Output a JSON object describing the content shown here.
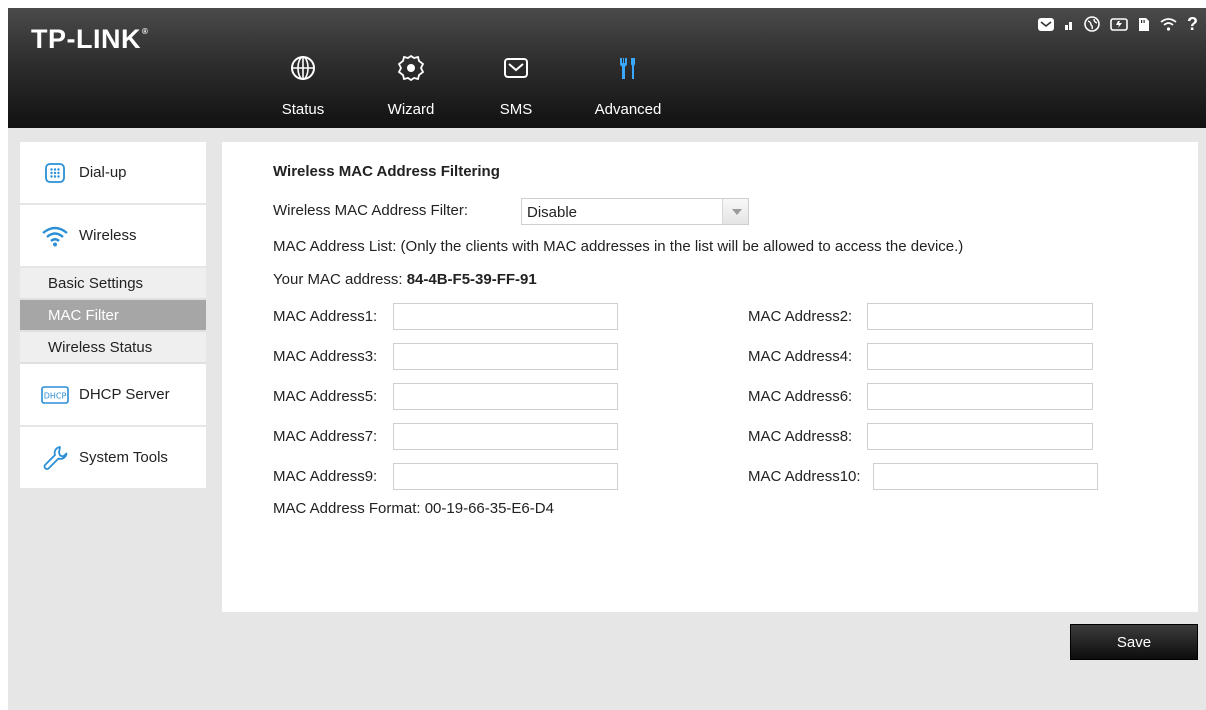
{
  "brand": {
    "logo_text": "TP-LINK",
    "logo_mark": "®"
  },
  "nav": {
    "items": [
      {
        "label": "Status",
        "icon": "globe-icon"
      },
      {
        "label": "Wizard",
        "icon": "gear-icon"
      },
      {
        "label": "SMS",
        "icon": "envelope-icon"
      },
      {
        "label": "Advanced",
        "icon": "tools-icon",
        "active": true
      }
    ]
  },
  "status_bar": {
    "icons": [
      "envelope-icon",
      "signal-icon",
      "globe-icon",
      "battery-icon",
      "sim-icon",
      "wifi-icon",
      "help-icon"
    ],
    "help_glyph": "?"
  },
  "sidebar": {
    "groups": [
      {
        "label": "Dial-up",
        "icon": "dialpad-icon"
      },
      {
        "label": "Wireless",
        "icon": "wifi-icon"
      },
      {
        "label": "DHCP Server",
        "icon": "dhcp-icon"
      },
      {
        "label": "System Tools",
        "icon": "wrench-icon"
      }
    ],
    "wireless_sub": [
      "Basic Settings",
      "MAC Filter",
      "Wireless Status"
    ],
    "active_sub": "MAC Filter",
    "dhcp_icon_text": "DHCP"
  },
  "content": {
    "title": "Wireless MAC Address Filtering",
    "filter_label": "Wireless MAC Address Filter:",
    "filter_value": "Disable",
    "list_note": "MAC Address List: (Only the clients with MAC addresses in the list will be allowed to access the device.)",
    "your_mac_label": "Your MAC address: ",
    "your_mac_value": "84-4B-F5-39-FF-91",
    "mac_fields": [
      {
        "label": "MAC Address1:",
        "value": ""
      },
      {
        "label": "MAC Address2:",
        "value": ""
      },
      {
        "label": "MAC Address3:",
        "value": ""
      },
      {
        "label": "MAC Address4:",
        "value": ""
      },
      {
        "label": "MAC Address5:",
        "value": ""
      },
      {
        "label": "MAC Address6:",
        "value": ""
      },
      {
        "label": "MAC Address7:",
        "value": ""
      },
      {
        "label": "MAC Address8:",
        "value": ""
      },
      {
        "label": "MAC Address9:",
        "value": ""
      },
      {
        "label": "MAC Address10:",
        "value": ""
      }
    ],
    "format_note": "MAC Address Format: 00-19-66-35-E6-D4"
  },
  "actions": {
    "save_label": "Save"
  },
  "colors": {
    "header_dark": "#111111",
    "active_sub_bg": "#a6a6a6",
    "wifi_blue": "#2a8fd6",
    "page_bg": "#e6e6e6"
  }
}
